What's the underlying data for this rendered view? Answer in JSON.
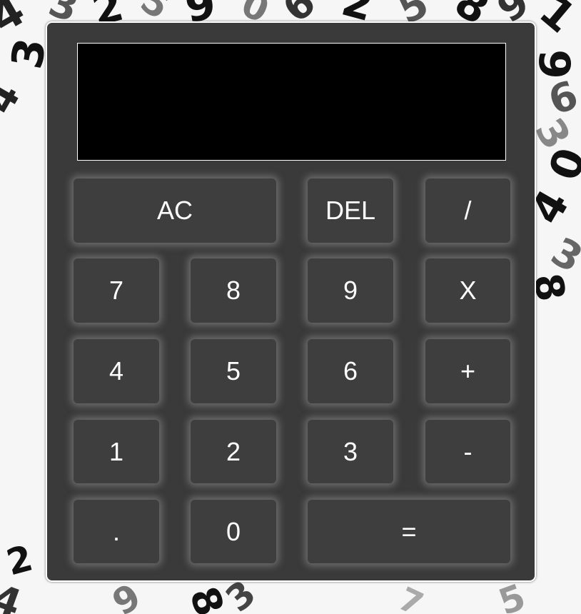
{
  "display": {
    "value": ""
  },
  "keys": {
    "clear": "AC",
    "delete": "DEL",
    "divide": "/",
    "seven": "7",
    "eight": "8",
    "nine": "9",
    "multiply": "X",
    "four": "4",
    "five": "5",
    "six": "6",
    "plus": "+",
    "one": "1",
    "two": "2",
    "three": "3",
    "minus": "-",
    "decimal": ".",
    "zero": "0",
    "equals": "="
  },
  "colors": {
    "body": "#3a3a3a",
    "key": "#3e3e3e",
    "display": "#000000",
    "text": "#ffffff"
  }
}
